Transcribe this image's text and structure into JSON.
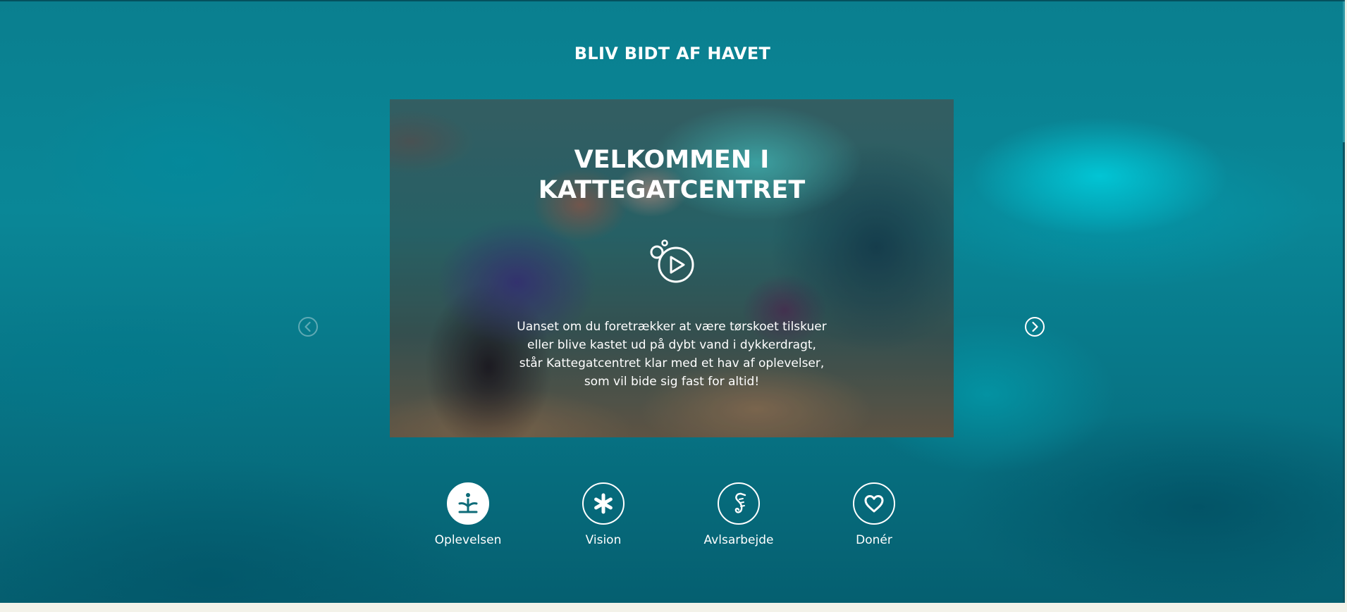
{
  "section": {
    "title": "BLIV BIDT AF HAVET"
  },
  "video": {
    "title_line1": "VELKOMMEN I",
    "title_line2": "KATTEGATCENTRET",
    "play_icon": "play-bubble-icon",
    "description_lines": [
      "Uanset om du foretrækker at være tørskoet tilskuer",
      "eller blive kastet ud på dybt vand i dykkerdragt,",
      "står Kattegatcentret klar med et hav af oplevelser,",
      "som vil bide sig fast for altid!"
    ]
  },
  "carousel": {
    "prev_icon": "chevron-left-icon",
    "next_icon": "chevron-right-icon"
  },
  "nav": {
    "items": [
      {
        "label": "Oplevelsen",
        "icon": "coral-plant-icon",
        "active": true
      },
      {
        "label": "Vision",
        "icon": "asterisk-starfish-icon",
        "active": false
      },
      {
        "label": "Avlsarbejde",
        "icon": "seahorse-icon",
        "active": false
      },
      {
        "label": "Donér",
        "icon": "heart-icon",
        "active": false
      }
    ]
  },
  "colors": {
    "background_teal": "#0a8797",
    "accent_white": "#ffffff",
    "icon_active": "#0e6b78",
    "footer_cream": "#f3f2e9"
  }
}
